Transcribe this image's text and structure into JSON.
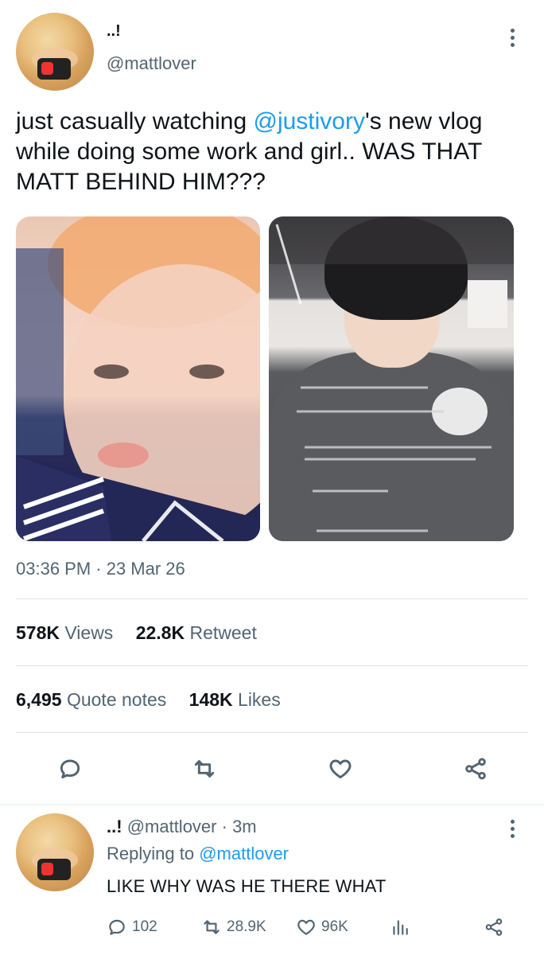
{
  "tweet": {
    "author_name": "..!",
    "author_handle": "@mattlover",
    "text_before": "just casually watching ",
    "mention": "@justivory",
    "text_after": "'s new vlog while doing some work and girl.. WAS THAT MATT BEHIND HIM???",
    "timestamp": "03:36 PM · 23 Mar 26",
    "stats": {
      "views_count": "578K",
      "views_label": "Views",
      "retweets_count": "22.8K",
      "retweets_label": "Retweet",
      "quotes_count": "6,495",
      "quotes_label": "Quote notes",
      "likes_count": "148K",
      "likes_label": "Likes"
    },
    "actions": [
      "reply-icon",
      "retweet-icon",
      "like-icon",
      "share-icon"
    ]
  },
  "reply": {
    "author_name": "..!",
    "author_handle": "@mattlover",
    "time": "· 3m",
    "replying_label": "Replying to",
    "replying_handle": "@mattlover",
    "text": "LIKE WHY WAS HE THERE WHAT",
    "counts": {
      "replies": "102",
      "retweets": "28.9K",
      "likes": "96K"
    }
  },
  "colors": {
    "accent": "#1d9bf0",
    "secondary_text": "#536471",
    "primary_text": "#0f1419"
  }
}
